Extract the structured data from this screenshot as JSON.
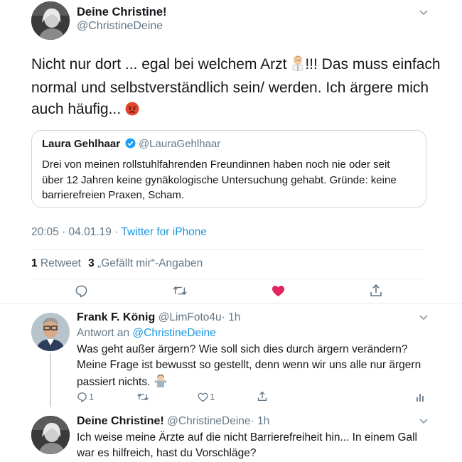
{
  "main_tweet": {
    "author_name": "Deine Christine!",
    "author_handle": "@ChristineDeine",
    "text_line1": "Nicht nur dort ... egal bei welchem Arzt ",
    "text_line1_after": "!!! Das muss einfach",
    "text_line2": "normal und selbstverständlich sein/ werden. Ich ärgere mich",
    "text_line3": "auch häufig... ",
    "emoji_1": "doctor-emoji",
    "emoji_2": "angry-face-emoji",
    "quoted": {
      "author_name": "Laura Gehlhaar",
      "author_handle": "@LauraGehlhaar",
      "verified": true,
      "line1": "Drei von meinen rollstuhlfahrenden Freundinnen haben noch nie oder seit",
      "line2": "über 12 Jahren keine gynäkologische Untersuchung gehabt. Gründe: keine",
      "line3": "barrierefreien Praxen, Scham."
    },
    "time": "20:05 · 04.01.19 · ",
    "source": "Twitter for iPhone",
    "retweet_count": "1",
    "retweet_label": " Retweet",
    "likes_count": "3",
    "likes_label": " „Gefällt mir“-Angaben",
    "liked": true,
    "colors": {
      "like_active": "#e0245e",
      "link": "#1b95e0",
      "muted": "#657786"
    }
  },
  "replies": [
    {
      "author_name": "Frank F. König",
      "author_handle": "@LimFoto4u",
      "time": "· 1h",
      "reply_to_prefix": "Antwort an ",
      "reply_to_handle": "@ChristineDeine",
      "line1": "Was geht außer ärgern? Wie soll sich dies durch ärgern verändern?",
      "line2": "Meine Frage ist bewusst so gestellt, denn wenn wir uns alle nur ärgern",
      "line3": "passiert nichts. ",
      "emoji": "man-shrugging-emoji",
      "reply_count": "1",
      "like_count": "1"
    },
    {
      "author_name": "Deine Christine!",
      "author_handle": "@ChristineDeine",
      "time": "· 1h",
      "line1": "Ich weise meine Ärzte auf die nicht Barrierefreiheit hin... In einem Gall",
      "line2": "war es hilfreich, hast du Vorschläge?"
    }
  ]
}
